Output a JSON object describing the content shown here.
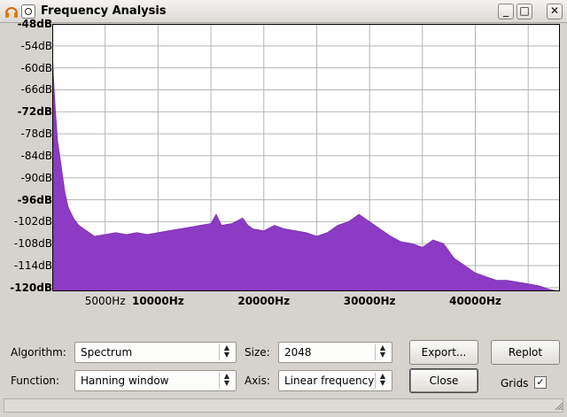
{
  "window": {
    "title": "Frequency Analysis",
    "minimize_glyph": "_",
    "maximize_glyph": "□",
    "close_glyph": "✕"
  },
  "chart_data": {
    "type": "area",
    "title": "",
    "xlabel": "",
    "ylabel": "",
    "x_unit": "Hz",
    "y_unit": "dB",
    "xlim": [
      0,
      48000
    ],
    "ylim": [
      -121,
      -48
    ],
    "grid": true,
    "color": "#8c3bc4",
    "y_ticks": [
      {
        "label": "-48dB",
        "value": -48,
        "bold": true
      },
      {
        "label": "-54dB",
        "value": -54,
        "bold": false
      },
      {
        "label": "-60dB",
        "value": -60,
        "bold": false
      },
      {
        "label": "-66dB",
        "value": -66,
        "bold": false
      },
      {
        "label": "-72dB",
        "value": -72,
        "bold": true
      },
      {
        "label": "-78dB",
        "value": -78,
        "bold": false
      },
      {
        "label": "-84dB",
        "value": -84,
        "bold": false
      },
      {
        "label": "-90dB",
        "value": -90,
        "bold": false
      },
      {
        "label": "-96dB",
        "value": -96,
        "bold": true
      },
      {
        "label": "-102dB",
        "value": -102,
        "bold": false
      },
      {
        "label": "-108dB",
        "value": -108,
        "bold": false
      },
      {
        "label": "-114dB",
        "value": -114,
        "bold": false
      },
      {
        "label": "-120dB",
        "value": -120,
        "bold": true
      }
    ],
    "x_ticks": [
      {
        "label": "5000Hz",
        "value": 5000,
        "bold": false
      },
      {
        "label": "10000Hz",
        "value": 10000,
        "bold": true
      },
      {
        "label": "20000Hz",
        "value": 20000,
        "bold": true
      },
      {
        "label": "30000Hz",
        "value": 30000,
        "bold": true
      },
      {
        "label": "40000Hz",
        "value": 40000,
        "bold": true
      }
    ],
    "x_grid": [
      5000,
      10000,
      15000,
      20000,
      25000,
      30000,
      35000,
      40000,
      45000
    ],
    "y_grid": [
      -54,
      -60,
      -66,
      -72,
      -78,
      -84,
      -90,
      -96,
      -102,
      -108,
      -114,
      -120
    ],
    "series": [
      {
        "x": [
          0,
          100,
          300,
          500,
          800,
          1000,
          1200,
          1500,
          2000,
          2500,
          3000,
          3500,
          4000,
          5000,
          6000,
          7000,
          8000,
          9000,
          10000,
          11000,
          12000,
          13000,
          14000,
          15000,
          15500,
          16000,
          17000,
          18000,
          18500,
          19000,
          20000,
          21000,
          22000,
          23000,
          24000,
          25000,
          26000,
          27000,
          28000,
          29000,
          30000,
          31000,
          32000,
          33000,
          34000,
          35000,
          36000,
          37000,
          38000,
          39000,
          40000,
          41000,
          42000,
          43000,
          44000,
          45000,
          46000,
          47000,
          48000
        ],
        "y": [
          -55,
          -62,
          -72,
          -80,
          -86,
          -90,
          -94,
          -98,
          -101,
          -103,
          -104,
          -105,
          -106,
          -105.5,
          -105,
          -105.5,
          -105,
          -105.5,
          -105,
          -104.5,
          -104,
          -103.5,
          -103,
          -102.5,
          -100,
          -103,
          -102.5,
          -101,
          -103,
          -104,
          -104.5,
          -103,
          -104,
          -104.5,
          -105,
          -106,
          -105,
          -103,
          -102,
          -100,
          -102,
          -104,
          -106,
          -107.5,
          -108,
          -109,
          -107,
          -108,
          -112,
          -114,
          -116,
          -117,
          -118,
          -118,
          -118.5,
          -119,
          -119.5,
          -120.5,
          -121
        ]
      }
    ]
  },
  "controls": {
    "algorithm_label": "Algorithm:",
    "algorithm_value": "Spectrum",
    "size_label": "Size:",
    "size_value": "2048",
    "function_label": "Function:",
    "function_value": "Hanning window",
    "axis_label": "Axis:",
    "axis_value": "Linear frequency",
    "export_label": "Export...",
    "replot_label": "Replot",
    "close_label": "Close",
    "grids_label": "Grids",
    "grids_checked": "✓"
  }
}
